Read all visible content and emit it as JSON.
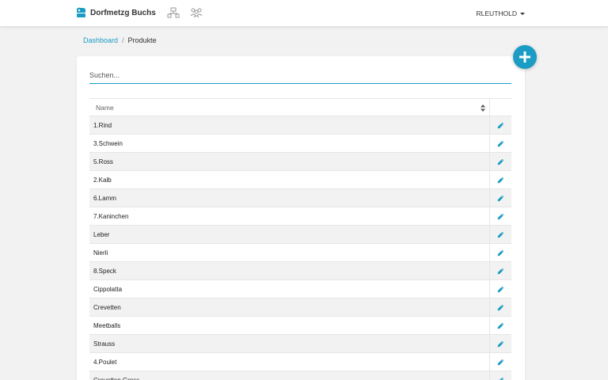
{
  "header": {
    "brand": "Dorfmetzg Buchs",
    "nav_icons": [
      "sitemap-icon",
      "users-icon"
    ],
    "user": "RLEUTHOLD"
  },
  "breadcrumb": {
    "home": "Dashboard",
    "separator": "/",
    "current": "Produkte"
  },
  "search": {
    "placeholder": "Suchen...",
    "value": ""
  },
  "table": {
    "columns": [
      "Name",
      ""
    ],
    "rows": [
      "1.Rind",
      "3.Schwein",
      "5.Ross",
      "2.Kalb",
      "6.Lamm",
      "7.Kaninchen",
      "Leber",
      "Nierli",
      "8.Speck",
      "Cippolatta",
      "Crevetten",
      "Meetballs",
      "Strauss",
      "4.Poulet",
      "Crevetten Gross"
    ]
  },
  "colors": {
    "accent": "#1a9cc4",
    "background": "#f2f2f2",
    "row_alt": "#f2f2f2"
  }
}
